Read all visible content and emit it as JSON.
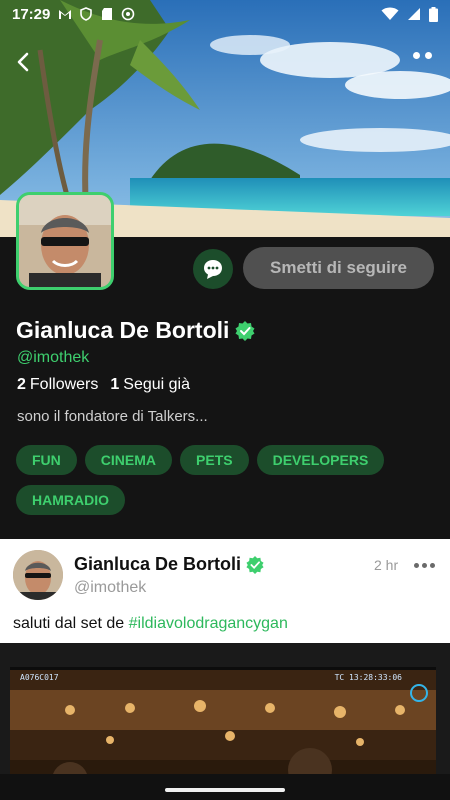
{
  "status_bar": {
    "time": "17:29",
    "left_icons": [
      "gmail-icon",
      "shield-icon",
      "sd-card-icon",
      "app-icon"
    ],
    "right_icons": [
      "wifi-icon",
      "signal-icon",
      "battery-icon"
    ]
  },
  "cover": {
    "description_icon": "beach-cover-image"
  },
  "profile": {
    "name": "Gianluca De Bortoli",
    "handle": "@imothek",
    "followers_count": "2",
    "followers_label": "Followers",
    "following_count": "1",
    "following_label": "Segui già",
    "bio": "sono il fondatore di Talkers...",
    "unfollow_label": "Smetti di seguire",
    "tags": [
      "FUN",
      "CINEMA",
      "PETS",
      "DEVELOPERS",
      "HAMRADIO"
    ]
  },
  "post": {
    "author": "Gianluca De Bortoli",
    "handle": "@imothek",
    "time": "2 hr",
    "text": "saluti dal set de ",
    "hashtag": "#ildiavolodragancygan",
    "media_hud_left": "A076C017",
    "media_hud_right": "TC 13:28:33:06"
  },
  "colors": {
    "accent": "#3ecf6e",
    "tag_bg": "#1c4d2b",
    "profile_bg": "#141414",
    "button_bg": "#505050"
  }
}
